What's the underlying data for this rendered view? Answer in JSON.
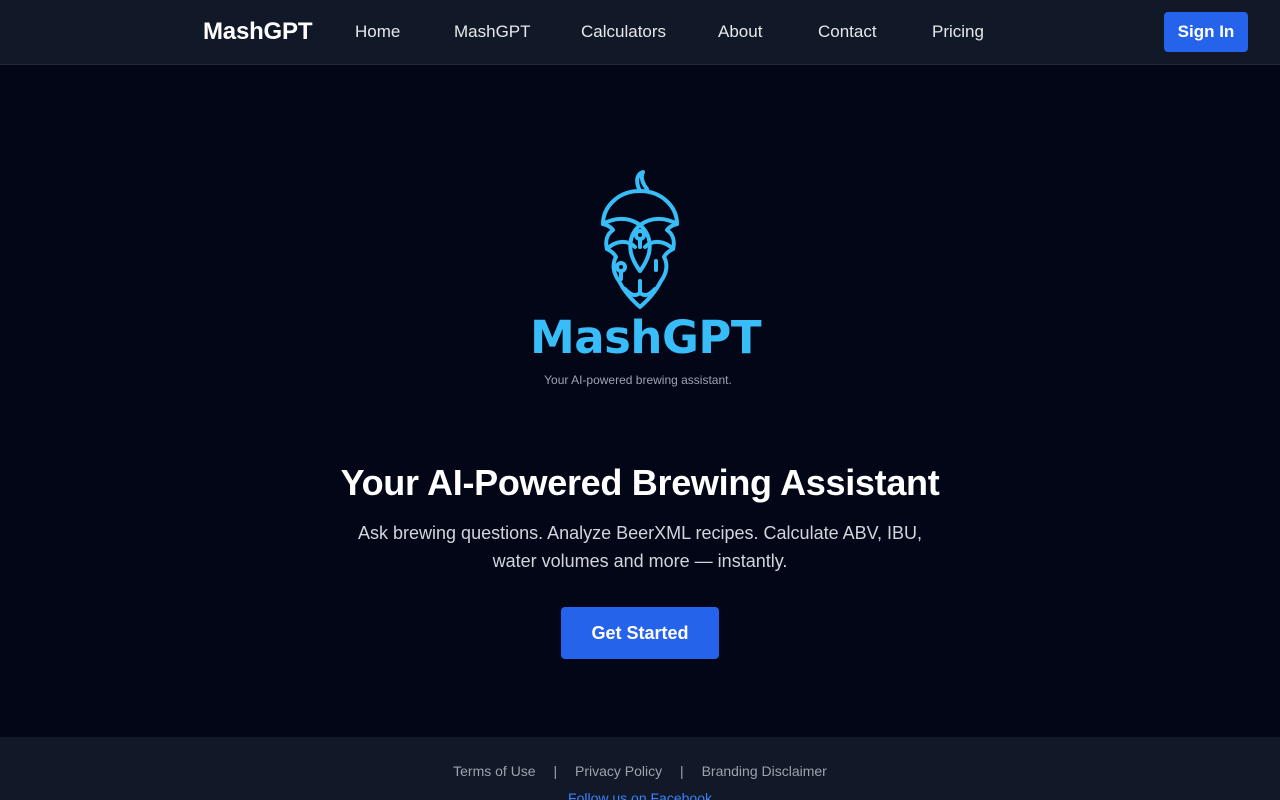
{
  "header": {
    "brand": "MashGPT",
    "nav": [
      "Home",
      "MashGPT",
      "Calculators",
      "About",
      "Contact",
      "Pricing"
    ],
    "sign_in": "Sign In"
  },
  "logo": {
    "icon": "hop-cone-icon",
    "wordmark": "MashGPT",
    "tagline": "Your AI-powered brewing assistant."
  },
  "hero": {
    "title": "Your AI-Powered Brewing Assistant",
    "subtitle_line1": "Ask brewing questions. Analyze BeerXML recipes. Calculate ABV, IBU,",
    "subtitle_line2": "water volumes and more — instantly.",
    "cta": "Get Started"
  },
  "footer": {
    "links": [
      "Terms of Use",
      "Privacy Policy",
      "Branding Disclaimer"
    ],
    "separator": "|",
    "social": "Follow us on Facebook"
  },
  "colors": {
    "accent": "#2563eb",
    "logo": "#38bdf8",
    "background": "#020617",
    "header_bg": "#111827"
  }
}
